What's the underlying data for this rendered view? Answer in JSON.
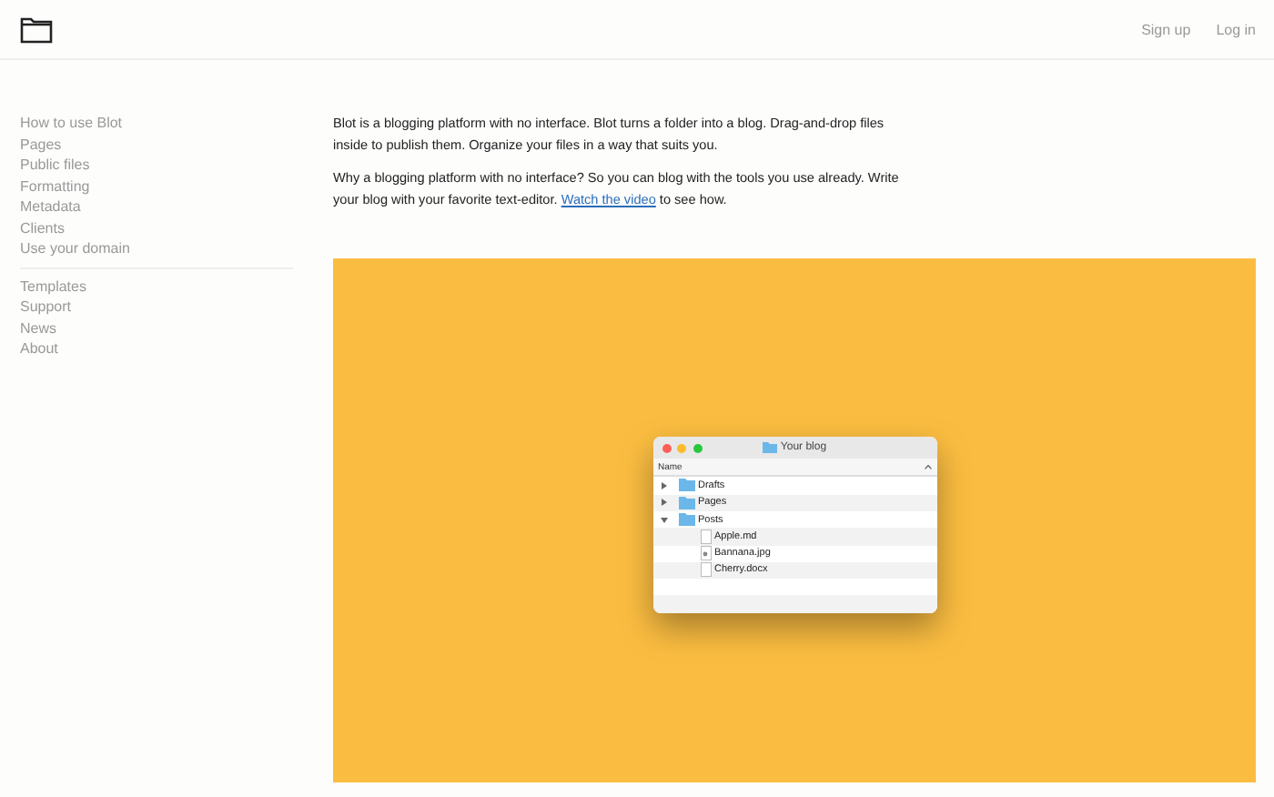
{
  "header": {
    "links": [
      "Sign up",
      "Log in"
    ]
  },
  "sidebar": {
    "groups": [
      {
        "items": [
          "How to use Blot",
          "Pages",
          "Public files",
          "Formatting",
          "Metadata",
          "Clients",
          "Use your domain"
        ]
      },
      {
        "items": [
          "Templates",
          "Support",
          "News",
          "About"
        ]
      }
    ]
  },
  "intro": [
    {
      "text": "Blot is a blogging platform with no interface. Blot turns a folder into a blog. Drag-and-drop files inside to publish them. Organize your files in a way that suits you."
    },
    {
      "text": "Why a blogging platform with no interface? So you can blog with the tools you use already. Write your blog with your favorite text-editor.",
      "link": "Watch the video",
      "after": "to see how."
    }
  ],
  "finder": {
    "title": "Your blog",
    "column": "Name",
    "tree": [
      {
        "name": "Drafts",
        "kind": "folder",
        "expanded": false
      },
      {
        "name": "Pages",
        "kind": "folder",
        "expanded": false
      },
      {
        "name": "Posts",
        "kind": "folder",
        "expanded": true,
        "children": [
          {
            "name": "Apple.md",
            "kind": "file"
          },
          {
            "name": "Bannana.jpg",
            "kind": "image"
          },
          {
            "name": "Cherry.docx",
            "kind": "file"
          }
        ]
      }
    ]
  }
}
